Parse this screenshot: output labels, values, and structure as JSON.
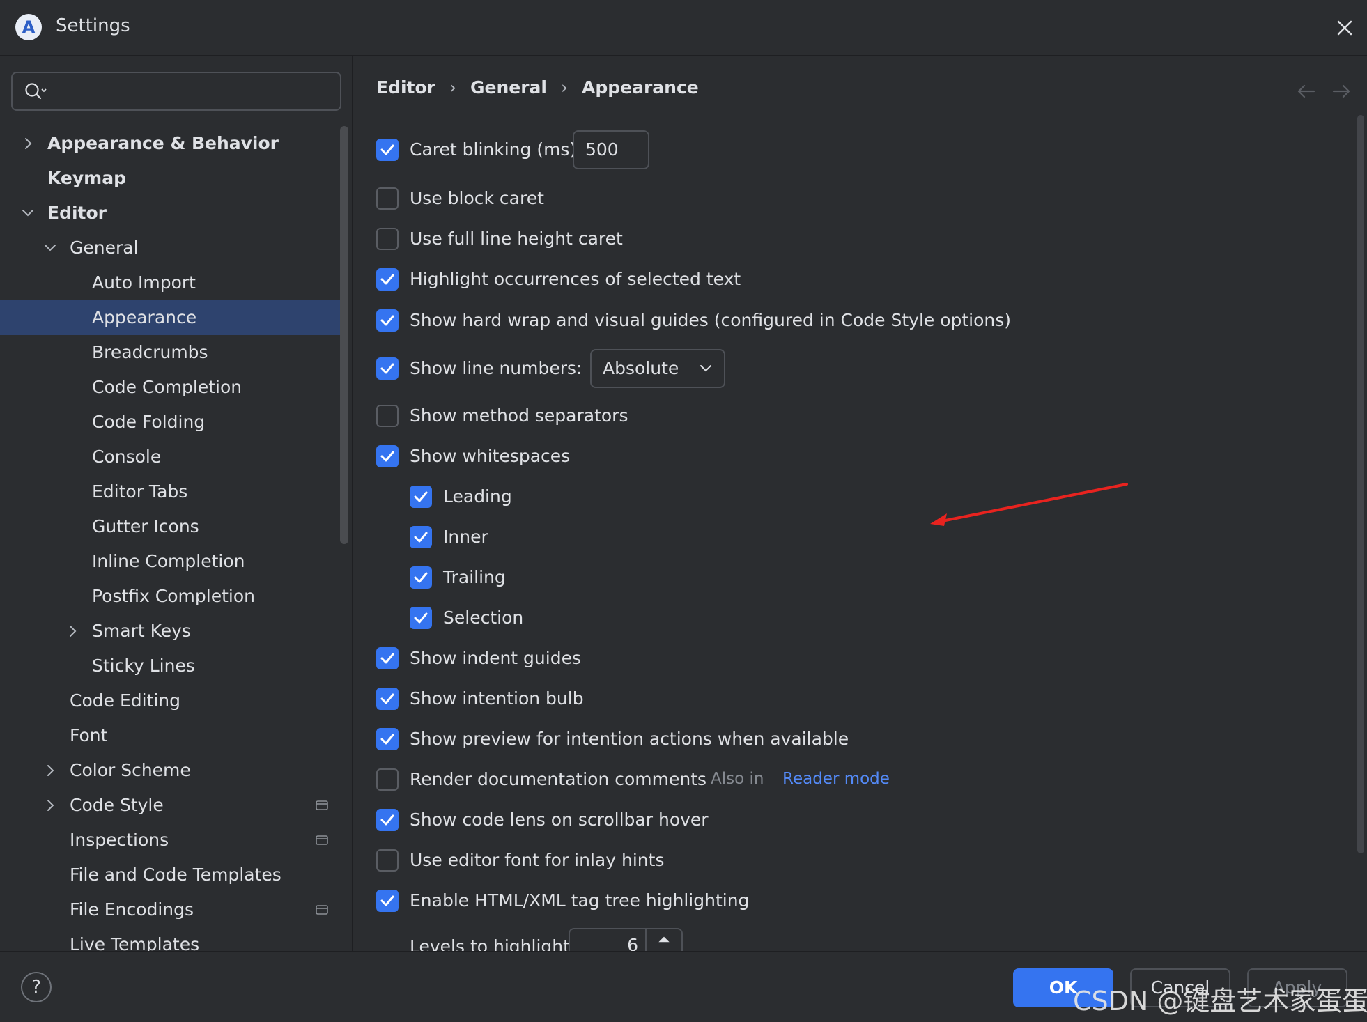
{
  "window": {
    "title": "Settings",
    "logo_letter": "A"
  },
  "search": {
    "placeholder": "",
    "value": ""
  },
  "sidebar": {
    "items": [
      {
        "label": "Appearance & Behavior",
        "level": 0,
        "chevron": "right",
        "bold": true
      },
      {
        "label": "Keymap",
        "level": 0,
        "chevron": "",
        "bold": true
      },
      {
        "label": "Editor",
        "level": 0,
        "chevron": "down",
        "bold": true
      },
      {
        "label": "General",
        "level": 1,
        "chevron": "down"
      },
      {
        "label": "Auto Import",
        "level": 2
      },
      {
        "label": "Appearance",
        "level": 2,
        "selected": true
      },
      {
        "label": "Breadcrumbs",
        "level": 2
      },
      {
        "label": "Code Completion",
        "level": 2
      },
      {
        "label": "Code Folding",
        "level": 2
      },
      {
        "label": "Console",
        "level": 2
      },
      {
        "label": "Editor Tabs",
        "level": 2
      },
      {
        "label": "Gutter Icons",
        "level": 2
      },
      {
        "label": "Inline Completion",
        "level": 2
      },
      {
        "label": "Postfix Completion",
        "level": 2
      },
      {
        "label": "Smart Keys",
        "level": 2,
        "chevron": "right"
      },
      {
        "label": "Sticky Lines",
        "level": 2
      },
      {
        "label": "Code Editing",
        "level": 1
      },
      {
        "label": "Font",
        "level": 1
      },
      {
        "label": "Color Scheme",
        "level": 1,
        "chevron": "right"
      },
      {
        "label": "Code Style",
        "level": 1,
        "chevron": "right",
        "project_icon": true
      },
      {
        "label": "Inspections",
        "level": 1,
        "project_icon": true
      },
      {
        "label": "File and Code Templates",
        "level": 1
      },
      {
        "label": "File Encodings",
        "level": 1,
        "project_icon": true
      },
      {
        "label": "Live Templates",
        "level": 1
      }
    ]
  },
  "breadcrumb": {
    "items": [
      "Editor",
      "General",
      "Appearance"
    ],
    "separator": "›"
  },
  "options": {
    "caret_blinking": {
      "label": "Caret blinking (ms):",
      "checked": true,
      "value": "500"
    },
    "block_caret": {
      "label": "Use block caret",
      "checked": false
    },
    "full_line_caret": {
      "label": "Use full line height caret",
      "checked": false
    },
    "highlight_occurrences": {
      "label": "Highlight occurrences of selected text",
      "checked": true
    },
    "hard_wrap": {
      "label": "Show hard wrap and visual guides (configured in Code Style options)",
      "checked": true
    },
    "line_numbers": {
      "label": "Show line numbers:",
      "checked": true,
      "value": "Absolute"
    },
    "method_separators": {
      "label": "Show method separators",
      "checked": false
    },
    "whitespaces": {
      "label": "Show whitespaces",
      "checked": true
    },
    "leading": {
      "label": "Leading",
      "checked": true
    },
    "inner": {
      "label": "Inner",
      "checked": true
    },
    "trailing": {
      "label": "Trailing",
      "checked": true
    },
    "selection": {
      "label": "Selection",
      "checked": true
    },
    "indent_guides": {
      "label": "Show indent guides",
      "checked": true
    },
    "intention_bulb": {
      "label": "Show intention bulb",
      "checked": true
    },
    "preview_intentions": {
      "label": "Show preview for intention actions when available",
      "checked": true
    },
    "render_docs": {
      "label": "Render documentation comments",
      "checked": false,
      "hint": "Also in",
      "link": "Reader mode"
    },
    "code_lens": {
      "label": "Show code lens on scrollbar hover",
      "checked": true
    },
    "editor_font_inlay": {
      "label": "Use editor font for inlay hints",
      "checked": false
    },
    "tag_tree": {
      "label": "Enable HTML/XML tag tree highlighting",
      "checked": true
    },
    "levels": {
      "label": "Levels to highlight:",
      "value": "6"
    }
  },
  "footer": {
    "ok": "OK",
    "cancel": "Cancel",
    "apply": "Apply"
  },
  "watermark": "CSDN @键盘艺术家蛋蛋",
  "colors": {
    "accent": "#3574f0",
    "selection": "#2e436e",
    "background": "#2b2d30",
    "link": "#548af7",
    "annotation": "#e8231f"
  }
}
